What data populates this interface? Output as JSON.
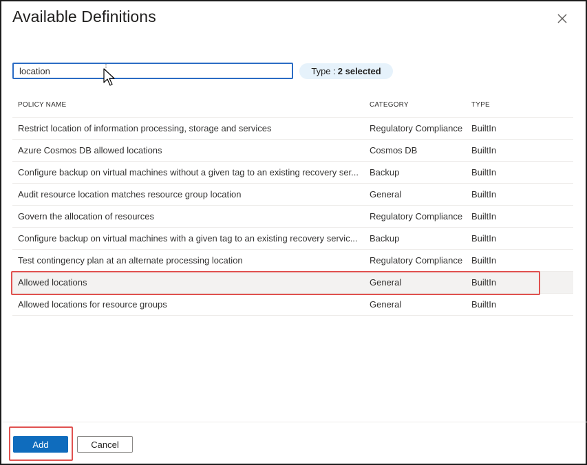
{
  "dialog": {
    "title": "Available Definitions",
    "close_icon": "close-icon"
  },
  "search": {
    "value": "location",
    "placeholder": ""
  },
  "filter": {
    "type_label": "Type :",
    "type_value": "2 selected"
  },
  "table": {
    "columns": [
      "POLICY NAME",
      "CATEGORY",
      "TYPE"
    ],
    "rows": [
      {
        "name": "Restrict location of information processing, storage and services",
        "category": "Regulatory Compliance",
        "type": "BuiltIn"
      },
      {
        "name": "Azure Cosmos DB allowed locations",
        "category": "Cosmos DB",
        "type": "BuiltIn"
      },
      {
        "name": "Configure backup on virtual machines without a given tag to an existing recovery ser...",
        "category": "Backup",
        "type": "BuiltIn"
      },
      {
        "name": "Audit resource location matches resource group location",
        "category": "General",
        "type": "BuiltIn"
      },
      {
        "name": "Govern the allocation of resources",
        "category": "Regulatory Compliance",
        "type": "BuiltIn"
      },
      {
        "name": "Configure backup on virtual machines with a given tag to an existing recovery servic...",
        "category": "Backup",
        "type": "BuiltIn"
      },
      {
        "name": "Test contingency plan at an alternate processing location",
        "category": "Regulatory Compliance",
        "type": "BuiltIn"
      },
      {
        "name": "Allowed locations",
        "category": "General",
        "type": "BuiltIn"
      },
      {
        "name": "Allowed locations for resource groups",
        "category": "General",
        "type": "BuiltIn"
      }
    ]
  },
  "footer": {
    "add_label": "Add",
    "cancel_label": "Cancel"
  },
  "colors": {
    "primary": "#0f6cbd",
    "focus_border": "#2b6cc4",
    "highlight_annotation": "#e0514f",
    "pill_bg": "#e6f2fb",
    "selected_row_bg": "#f3f2f1"
  }
}
